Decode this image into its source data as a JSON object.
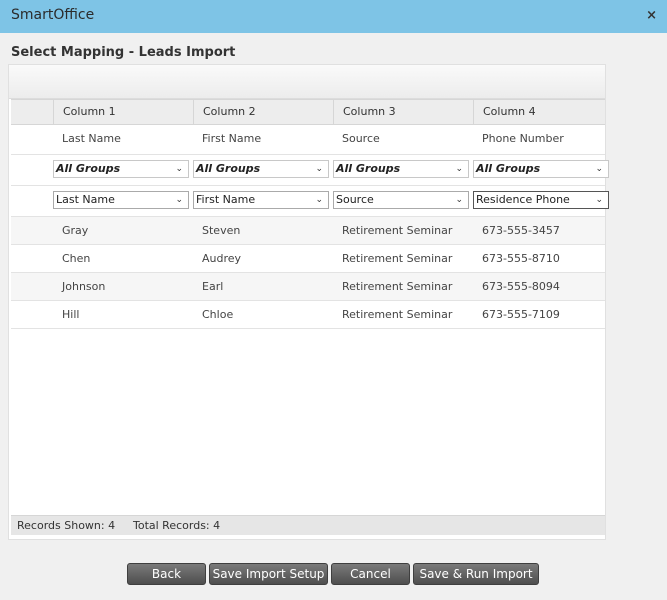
{
  "window": {
    "title": "SmartOffice",
    "close_glyph": "×"
  },
  "heading": "Select Mapping - Leads Import",
  "columns": [
    "Column 1",
    "Column 2",
    "Column 3",
    "Column 4"
  ],
  "source_headers": [
    "Last Name",
    "First Name",
    "Source",
    "Phone Number"
  ],
  "group_selects": [
    "All Groups",
    "All Groups",
    "All Groups",
    "All Groups"
  ],
  "field_selects": [
    "Last Name",
    "First Name",
    "Source",
    "Residence Phone"
  ],
  "rows": [
    [
      "Gray",
      "Steven",
      "Retirement Seminar",
      "673-555-3457"
    ],
    [
      "Chen",
      "Audrey",
      "Retirement Seminar",
      "673-555-8710"
    ],
    [
      "Johnson",
      "Earl",
      "Retirement Seminar",
      "673-555-8094"
    ],
    [
      "Hill",
      "Chloe",
      "Retirement Seminar",
      "673-555-7109"
    ]
  ],
  "footer": {
    "records_shown": "Records Shown: 4",
    "total_records": "Total Records: 4"
  },
  "buttons": {
    "back": "Back",
    "save_setup": "Save Import Setup",
    "cancel": "Cancel",
    "save_run": "Save & Run Import"
  },
  "icons": {
    "close": "close-icon",
    "dropdown": "chevron-down-icon"
  },
  "colors": {
    "titlebar": "#7ec4e6",
    "button": "#5f5f5f"
  }
}
